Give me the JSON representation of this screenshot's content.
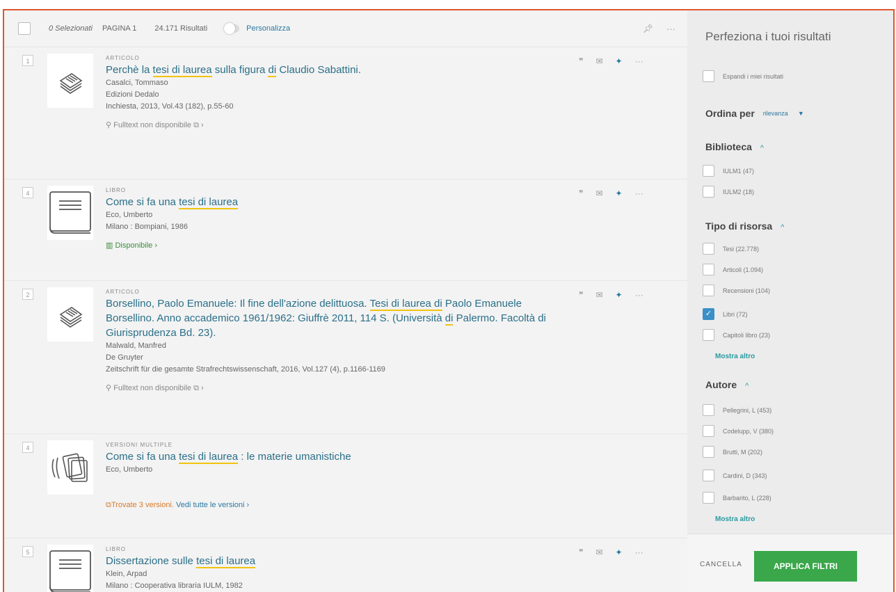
{
  "toolbar": {
    "selected": "0 Selezionati",
    "page": "PAGINA 1",
    "results": "24.171 Risultati",
    "personalize": "Personalizza",
    "pin_icon": "pin-icon",
    "more_icon": "ellipsis-icon"
  },
  "records": [
    {
      "index": "1",
      "type": "ARTICOLO",
      "icon": "article-icon",
      "title_parts": [
        "Perchè la ",
        "tesi di laurea",
        " sulla figura ",
        "di",
        " Claudio Sabattini."
      ],
      "lines": [
        "Casalci, Tommaso",
        "Edizioni Dedalo",
        "Inchiesta, 2013, Vol.43 (182), p.55-60"
      ],
      "availability": "Fulltext non disponibile",
      "availability_link": "",
      "availability_tail": "›",
      "avail_style": "grey"
    },
    {
      "index": "4",
      "type": "LIBRO",
      "icon": "book-icon",
      "title_parts": [
        "Come si fa una ",
        "tesi di laurea",
        "",
        "",
        ""
      ],
      "lines": [
        "Eco, Umberto",
        "Milano : Bompiani, 1986"
      ],
      "availability": "Disponibile",
      "availability_link": "",
      "availability_tail": "›",
      "avail_style": "green"
    },
    {
      "index": "2",
      "type": "ARTICOLO",
      "icon": "article-icon",
      "title_parts": [
        "Borsellino, Paolo Emanuele: Il fine dell'azione delittuosa. ",
        "Tesi di laurea di",
        " Paolo Emanuele Borsellino. Anno accademico 1961/1962: Giuffrè 2011, 114 S. (Università ",
        "di",
        " Palermo. Facoltà di Giurisprudenza Bd. 23)."
      ],
      "lines": [
        "Malwald, Manfred",
        "De Gruyter",
        "Zeitschrift für die gesamte Strafrechtswissenschaft, 2016, Vol.127 (4), p.1166-1169"
      ],
      "availability": "Fulltext non disponibile",
      "availability_link": "",
      "availability_tail": "›",
      "avail_style": "grey"
    },
    {
      "index": "4",
      "type": "VERSIONI MULTIPLE",
      "icon": "versions-icon",
      "title_parts": [
        "Come si fa una ",
        "tesi di laurea",
        " : le materie umanistiche",
        "",
        ""
      ],
      "lines": [
        "Eco, Umberto"
      ],
      "availability": "Trovate 3 versioni.",
      "availability_link": "Vedi tutte le versioni",
      "availability_tail": "›",
      "avail_style": "orange"
    },
    {
      "index": "5",
      "type": "LIBRO",
      "icon": "book-icon",
      "title_parts": [
        "Dissertazione sulle ",
        "tesi di laurea",
        "",
        "",
        ""
      ],
      "lines": [
        "Klein, Arpad",
        "Milano : Cooperativa libraria IULM, 1982"
      ],
      "availability": "",
      "availability_link": "",
      "availability_tail": "",
      "avail_style": "grey"
    }
  ],
  "sidebar": {
    "title": "Perfeziona i tuoi risultati",
    "expand": "Espandi i miei risultati",
    "sort_label": "Ordina per",
    "sort_value": "rilevanza",
    "library": {
      "label": "Biblioteca",
      "items": [
        "IULM1 (47)",
        "IULM2 (18)"
      ]
    },
    "resource_type": {
      "label": "Tipo di risorsa",
      "items": [
        "Tesi (22.778)",
        "Articoli (1.094)",
        "Recensioni (104)",
        "Libri (72)",
        "Capitoli libro (23)"
      ],
      "checked": [
        false,
        false,
        false,
        true,
        false
      ],
      "more": "Mostra altro"
    },
    "author": {
      "label": "Autore",
      "items": [
        "Pellegrini, L (453)",
        "Codelupp, V (380)",
        "Brutti, M (202)",
        "Cardini, D (343)",
        "Barbarito, L (228)"
      ],
      "more": "Mostra altro"
    },
    "cancel": "CANCELLA",
    "apply": "APPLICA FILTRI"
  }
}
